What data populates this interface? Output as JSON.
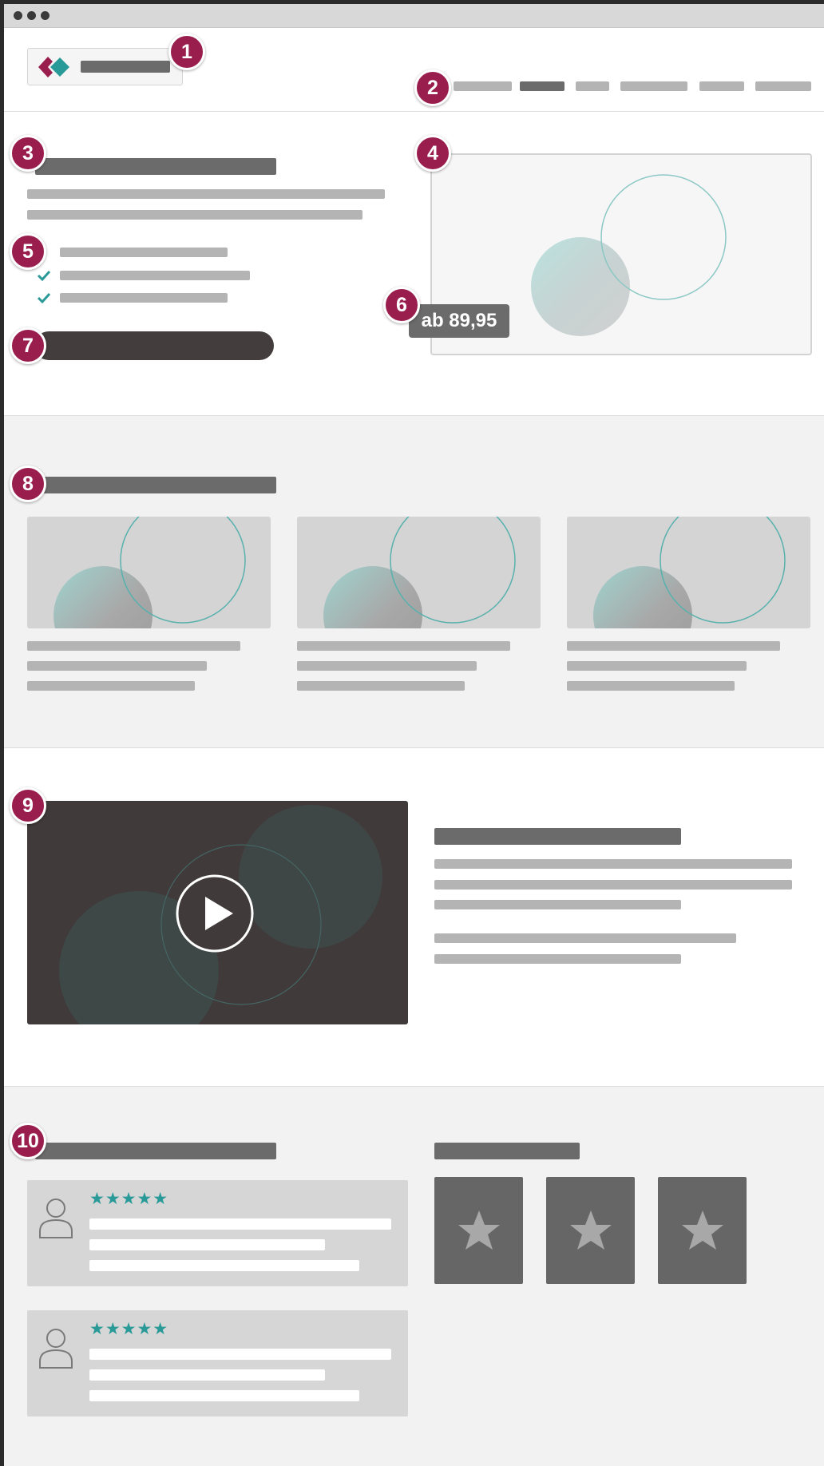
{
  "markers": [
    "1",
    "2",
    "3",
    "4",
    "5",
    "6",
    "7",
    "8",
    "9",
    "10"
  ],
  "hero": {
    "price_label": "ab 89,95",
    "checklist_icon": "checkmark-icon"
  },
  "reviews": {
    "rating_stars": "★★★★★",
    "avatar_icon": "user-icon"
  },
  "awards": {
    "badge_icon": "star-icon"
  },
  "colors": {
    "accent": "#9a1e4d",
    "teal": "#2a9a98",
    "dark_gray": "#6b6b6b",
    "light_gray": "#b4b4b4",
    "section_bg": "#f2f2f2"
  }
}
